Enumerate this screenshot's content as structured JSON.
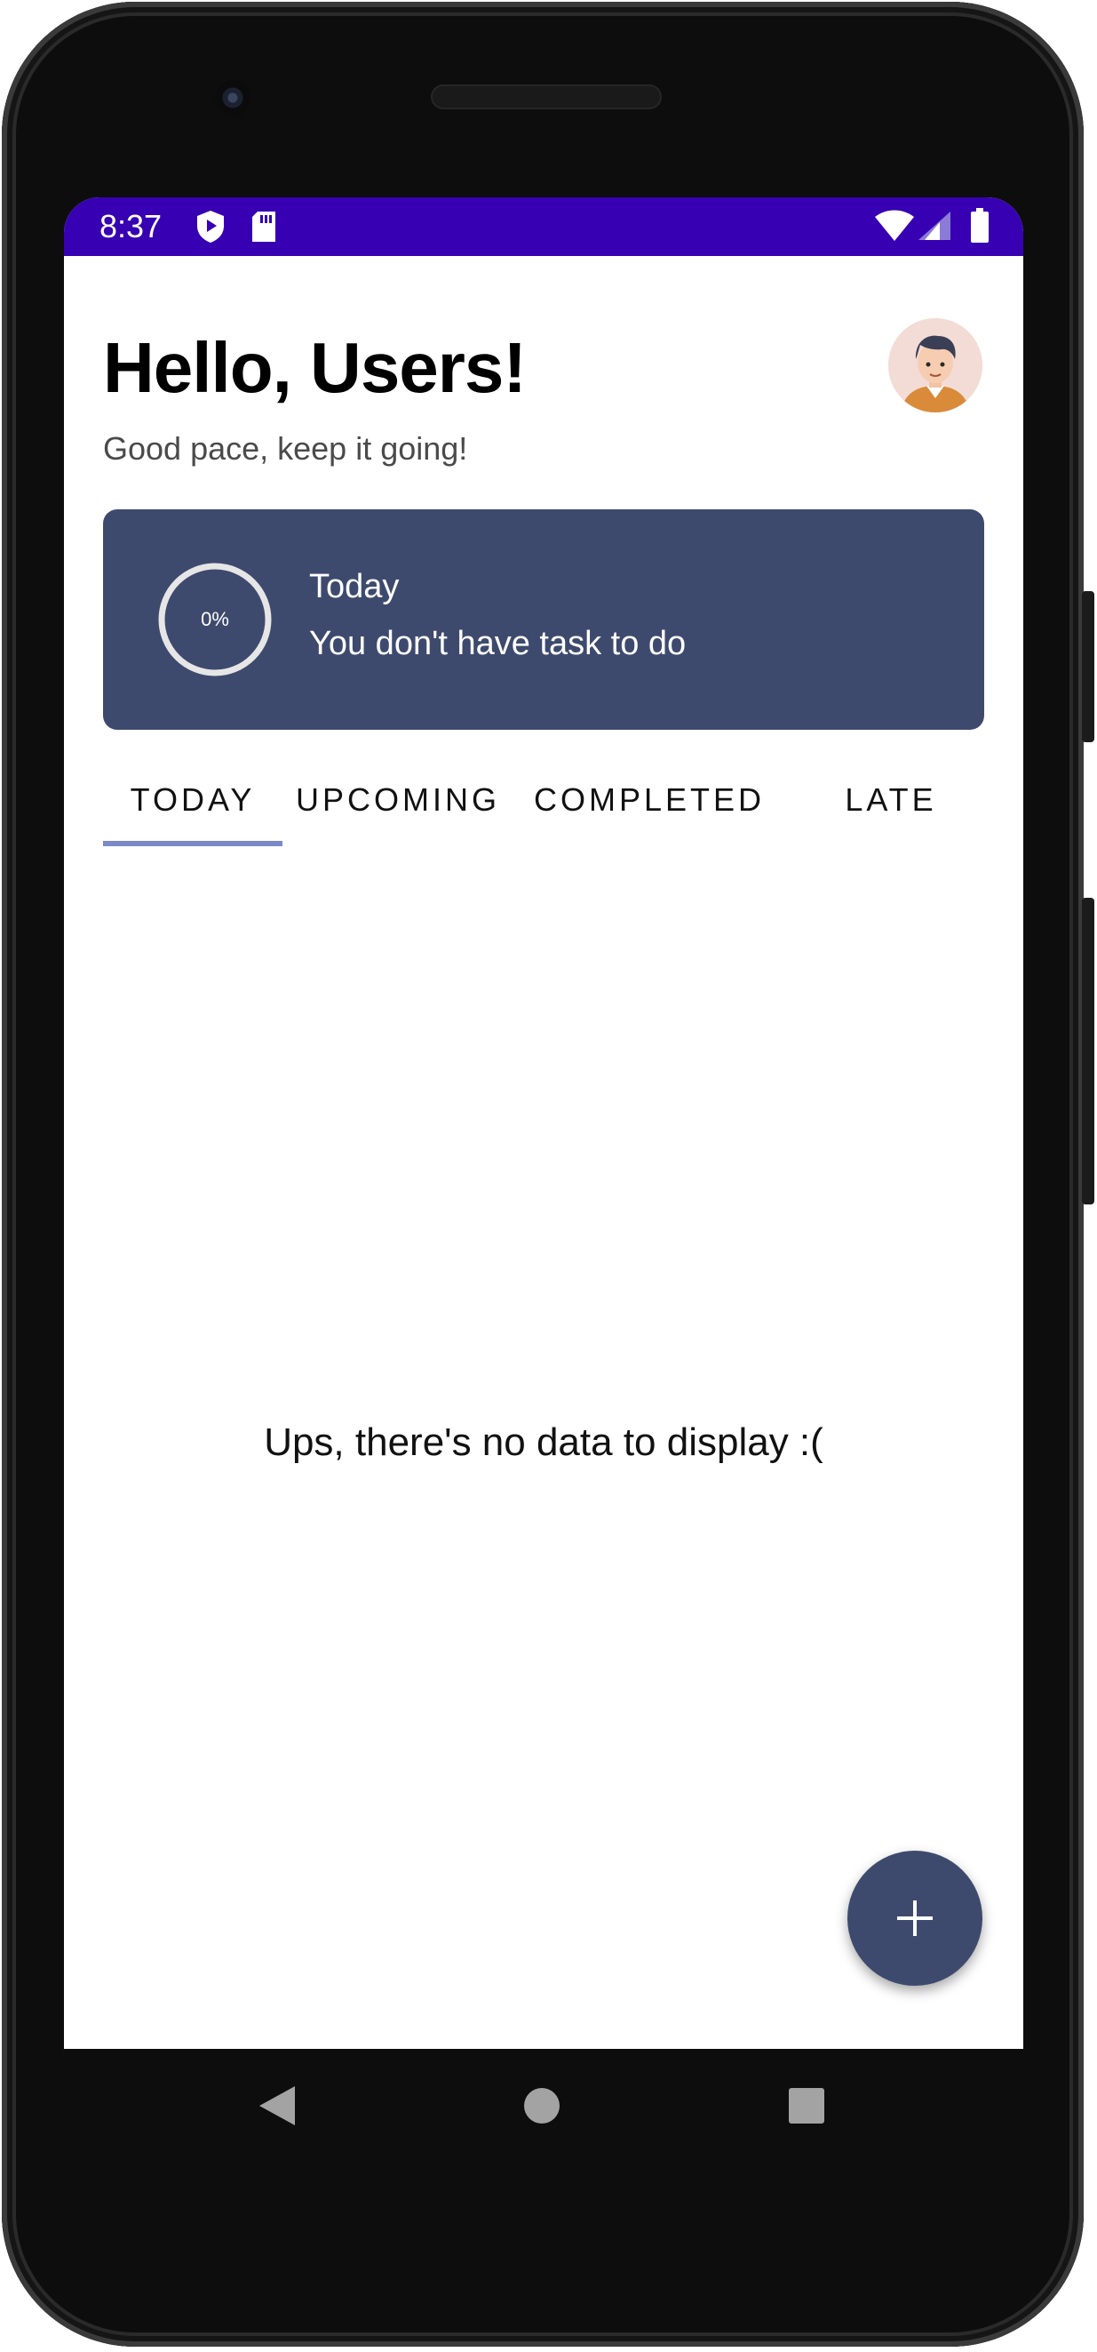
{
  "status_bar": {
    "time": "8:37",
    "icons": [
      "shield-play-icon",
      "sd-card-icon",
      "wifi-icon",
      "signal-icon",
      "battery-icon"
    ],
    "background": "#3700b3"
  },
  "header": {
    "greeting": "Hello, Users!",
    "subtitle": "Good pace, keep it going!"
  },
  "progress_card": {
    "percent_label": "0%",
    "progress": 0,
    "title": "Today",
    "message": "You don't have task to do",
    "background": "#3e4a6d"
  },
  "tabs": [
    {
      "label": "TODAY",
      "selected": true
    },
    {
      "label": "UPCOMING",
      "selected": false
    },
    {
      "label": "COMPLETED",
      "selected": false
    },
    {
      "label": "LATE",
      "selected": false
    }
  ],
  "tab_indicator_color": "#7b89c8",
  "empty_state": {
    "message": "Ups, there's no data to display :("
  },
  "fab": {
    "icon": "plus-icon"
  },
  "navigation": {
    "icons": [
      "back-icon",
      "home-icon",
      "recents-icon"
    ]
  }
}
